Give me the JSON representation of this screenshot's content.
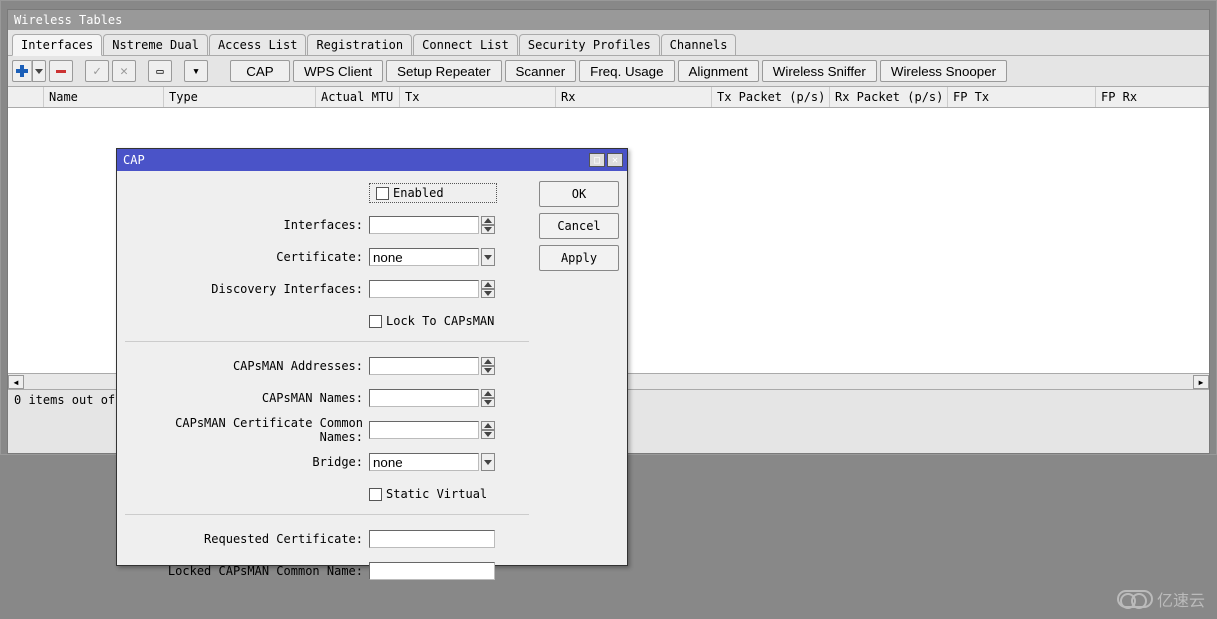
{
  "window": {
    "title": "Wireless Tables"
  },
  "tabs": {
    "interfaces": "Interfaces",
    "nstreme": "Nstreme Dual",
    "access": "Access List",
    "registration": "Registration",
    "connect": "Connect List",
    "security": "Security Profiles",
    "channels": "Channels"
  },
  "toolbar": {
    "cap": "CAP",
    "wps": "WPS Client",
    "repeater": "Setup Repeater",
    "scanner": "Scanner",
    "freq": "Freq. Usage",
    "align": "Alignment",
    "sniffer": "Wireless Sniffer",
    "snooper": "Wireless Snooper"
  },
  "columns": {
    "name": "Name",
    "type": "Type",
    "mtu": "Actual MTU",
    "tx": "Tx",
    "rx": "Rx",
    "txp": "Tx Packet (p/s)",
    "rxp": "Rx Packet (p/s)",
    "fptx": "FP Tx",
    "fprx": "FP Rx"
  },
  "status": "0 items out of",
  "cap": {
    "title": "CAP",
    "ok": "OK",
    "cancel": "Cancel",
    "apply": "Apply",
    "enabled": "Enabled",
    "interfaces": "Interfaces:",
    "certificate": "Certificate:",
    "certificate_value": "none",
    "discovery": "Discovery Interfaces:",
    "lock": "Lock To CAPsMAN",
    "addresses": "CAPsMAN Addresses:",
    "names": "CAPsMAN Names:",
    "cert_names": "CAPsMAN Certificate Common Names:",
    "bridge": "Bridge:",
    "bridge_value": "none",
    "static": "Static Virtual",
    "req_cert": "Requested Certificate:",
    "locked_cn": "Locked CAPsMAN Common Name:"
  },
  "watermark": "亿速云"
}
